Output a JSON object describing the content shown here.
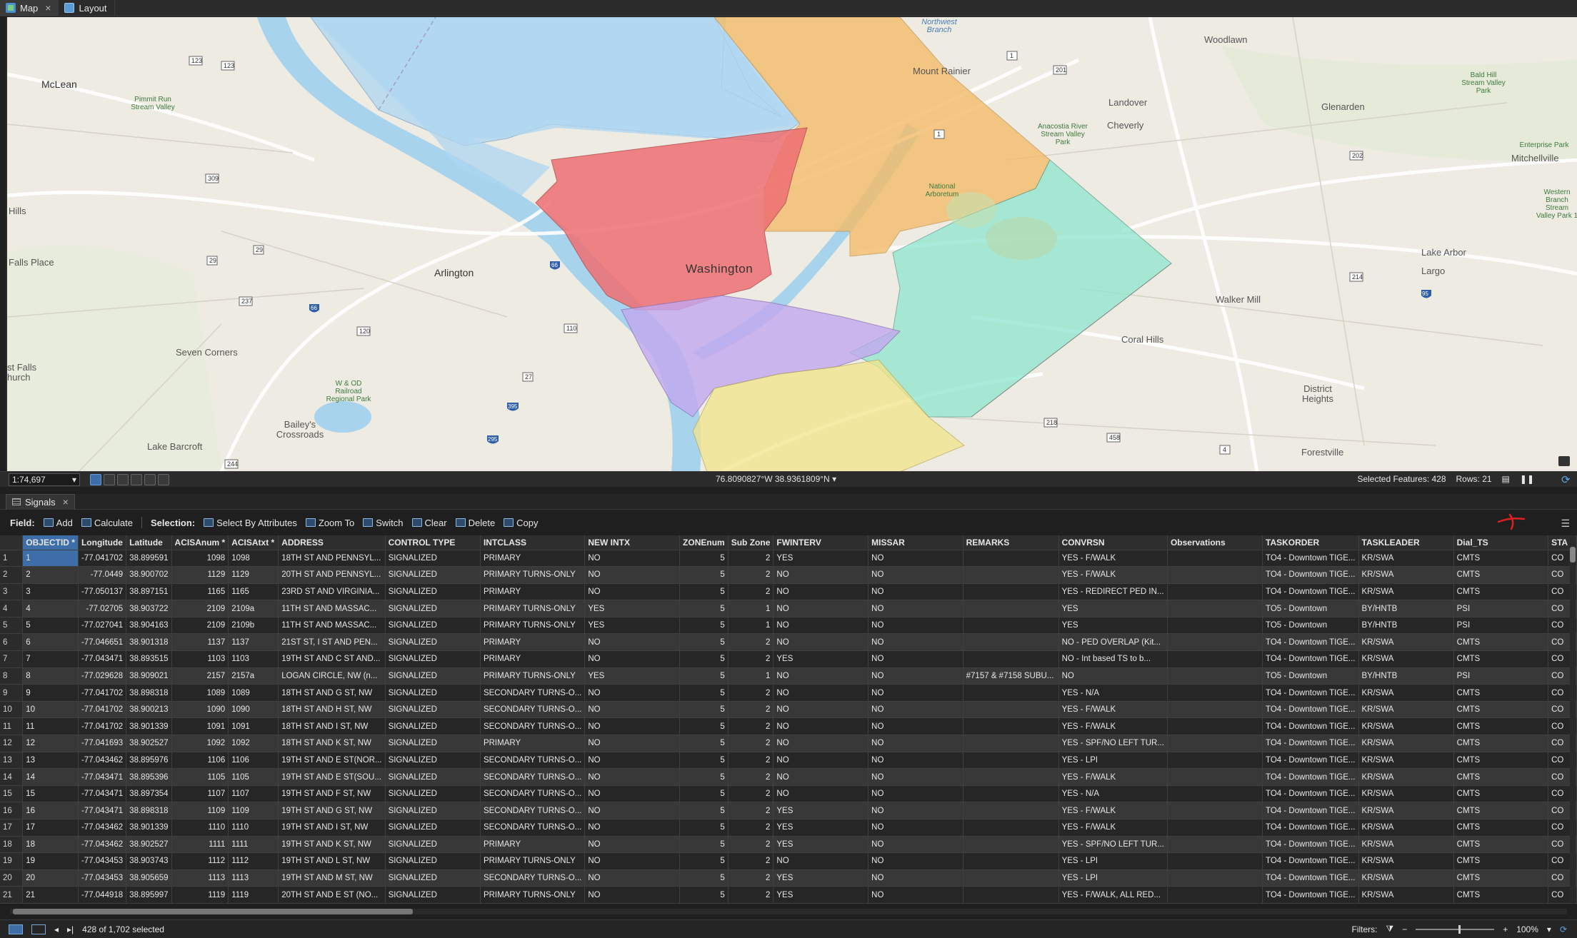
{
  "tabs": [
    {
      "label": "Map"
    },
    {
      "label": "Layout"
    }
  ],
  "map": {
    "labels": {
      "mclean": "McLean",
      "arlington": "Arlington",
      "washington": "Washington",
      "mount_rainier": "Mount Rainier",
      "woodlawn": "Woodlawn",
      "landover": "Landover",
      "cheverly": "Cheverly",
      "glenarden": "Glenarden",
      "mitchellville": "Mitchellville",
      "lake_arbor": "Lake Arbor",
      "largo": "Largo",
      "walker_mill": "Walker Mill",
      "coral_hills": "Coral Hills",
      "district_heights": "District Heights",
      "forestville": "Forestville",
      "seven_corners": "Seven Corners",
      "baileys": "Bailey's Crossroads",
      "lake_barcroft": "Lake Barcroft",
      "falls_place": "Falls Place",
      "hills": "Hills",
      "falls_church": "st Falls hurch",
      "northwest_branch": "Northwest Branch",
      "pimmit_run": "Pimmit Run Stream Valley",
      "wod_railroad": "W & OD Railroad Regional Park",
      "anacostia": "Anacostia River Stream Valley Park",
      "national_arboretum": "National Arboretum",
      "bald_hill": "Bald Hill Stream Valley Park",
      "enterprise_park": "Enterprise Park",
      "western_branch": "Western Branch Stream Valley Park 1"
    }
  },
  "mapbar": {
    "scale": "1:74,697",
    "coordinates": "76.8090827°W 38.9361809°N",
    "selected_features": "Selected Features: 428",
    "rows": "Rows: 21"
  },
  "pane": {
    "tab_label": "Signals"
  },
  "toolbar": {
    "field_label": "Field:",
    "add": "Add",
    "calculate": "Calculate",
    "selection_label": "Selection:",
    "select_by_attributes": "Select By Attributes",
    "zoom_to": "Zoom To",
    "switch": "Switch",
    "clear": "Clear",
    "delete": "Delete",
    "copy": "Copy"
  },
  "table": {
    "columns": [
      "OBJECTID *",
      "Longitude",
      "Latitude",
      "ACISAnum *",
      "ACISAtxt *",
      "ADDRESS",
      "CONTROL TYPE",
      "INTCLASS",
      "NEW INTX",
      "ZONEnum",
      "Sub Zone",
      "FWINTERV",
      "MISSAR",
      "REMARKS",
      "CONVRSN",
      "Observations",
      "TASKORDER",
      "TASKLEADER",
      "Dial_TS",
      "STA"
    ],
    "rows": [
      [
        "1",
        "1",
        "-77.041702",
        "38.899591",
        "1098",
        "1098",
        "18TH ST AND PENNSYL...",
        "SIGNALIZED",
        "PRIMARY",
        "NO",
        "5",
        "2",
        "YES",
        "NO",
        "",
        "YES - F/WALK",
        "",
        "TO4 - Downtown TIGE...",
        "KR/SWA",
        "CMTS",
        "CO"
      ],
      [
        "2",
        "2",
        "-77.0449",
        "38.900702",
        "1129",
        "1129",
        "20TH ST AND PENNSYL...",
        "SIGNALIZED",
        "PRIMARY TURNS-ONLY",
        "NO",
        "5",
        "2",
        "NO",
        "NO",
        "",
        "YES - F/WALK",
        "",
        "TO4 - Downtown TIGE...",
        "KR/SWA",
        "CMTS",
        "CO"
      ],
      [
        "3",
        "3",
        "-77.050137",
        "38.897151",
        "1165",
        "1165",
        "23RD ST AND VIRGINIA...",
        "SIGNALIZED",
        "PRIMARY",
        "NO",
        "5",
        "2",
        "NO",
        "NO",
        "",
        "YES - REDIRECT PED IN...",
        "",
        "TO4 - Downtown TIGE...",
        "KR/SWA",
        "CMTS",
        "CO"
      ],
      [
        "4",
        "4",
        "-77.02705",
        "38.903722",
        "2109",
        "2109a",
        "11TH ST AND MASSAC...",
        "SIGNALIZED",
        "PRIMARY TURNS-ONLY",
        "YES",
        "5",
        "1",
        "NO",
        "NO",
        "",
        "YES",
        "",
        "TO5 - Downtown",
        "BY/HNTB",
        "PSI",
        "CO"
      ],
      [
        "5",
        "5",
        "-77.027041",
        "38.904163",
        "2109",
        "2109b",
        "11TH ST AND MASSAC...",
        "SIGNALIZED",
        "PRIMARY TURNS-ONLY",
        "YES",
        "5",
        "1",
        "NO",
        "NO",
        "",
        "YES",
        "",
        "TO5 - Downtown",
        "BY/HNTB",
        "PSI",
        "CO"
      ],
      [
        "6",
        "6",
        "-77.046651",
        "38.901318",
        "1137",
        "1137",
        "21ST ST, I ST AND PEN...",
        "SIGNALIZED",
        "PRIMARY",
        "NO",
        "5",
        "2",
        "NO",
        "NO",
        "",
        "NO - PED OVERLAP (Kit...",
        "",
        "TO4 - Downtown TIGE...",
        "KR/SWA",
        "CMTS",
        "CO"
      ],
      [
        "7",
        "7",
        "-77.043471",
        "38.893515",
        "1103",
        "1103",
        "19TH ST AND C ST AND...",
        "SIGNALIZED",
        "PRIMARY",
        "NO",
        "5",
        "2",
        "YES",
        "NO",
        "",
        "NO - Int based TS to b...",
        "",
        "TO4 - Downtown TIGE...",
        "KR/SWA",
        "CMTS",
        "CO"
      ],
      [
        "8",
        "8",
        "-77.029628",
        "38.909021",
        "2157",
        "2157a",
        "LOGAN CIRCLE, NW (n...",
        "SIGNALIZED",
        "PRIMARY TURNS-ONLY",
        "YES",
        "5",
        "1",
        "NO",
        "NO",
        "#7157 & #7158 SUBU...",
        "NO",
        "",
        "TO5 - Downtown",
        "BY/HNTB",
        "PSI",
        "CO"
      ],
      [
        "9",
        "9",
        "-77.041702",
        "38.898318",
        "1089",
        "1089",
        "18TH ST AND G ST, NW",
        "SIGNALIZED",
        "SECONDARY TURNS-O...",
        "NO",
        "5",
        "2",
        "NO",
        "NO",
        "",
        "YES - N/A",
        "",
        "TO4 - Downtown TIGE...",
        "KR/SWA",
        "CMTS",
        "CO"
      ],
      [
        "10",
        "10",
        "-77.041702",
        "38.900213",
        "1090",
        "1090",
        "18TH ST AND H ST, NW",
        "SIGNALIZED",
        "SECONDARY TURNS-O...",
        "NO",
        "5",
        "2",
        "NO",
        "NO",
        "",
        "YES - F/WALK",
        "",
        "TO4 - Downtown TIGE...",
        "KR/SWA",
        "CMTS",
        "CO"
      ],
      [
        "11",
        "11",
        "-77.041702",
        "38.901339",
        "1091",
        "1091",
        "18TH ST AND I ST, NW",
        "SIGNALIZED",
        "SECONDARY TURNS-O...",
        "NO",
        "5",
        "2",
        "NO",
        "NO",
        "",
        "YES - F/WALK",
        "",
        "TO4 - Downtown TIGE...",
        "KR/SWA",
        "CMTS",
        "CO"
      ],
      [
        "12",
        "12",
        "-77.041693",
        "38.902527",
        "1092",
        "1092",
        "18TH ST AND K ST, NW",
        "SIGNALIZED",
        "PRIMARY",
        "NO",
        "5",
        "2",
        "NO",
        "NO",
        "",
        "YES - SPF/NO LEFT TUR...",
        "",
        "TO4 - Downtown TIGE...",
        "KR/SWA",
        "CMTS",
        "CO"
      ],
      [
        "13",
        "13",
        "-77.043462",
        "38.895976",
        "1106",
        "1106",
        "19TH ST AND E ST(NOR...",
        "SIGNALIZED",
        "SECONDARY TURNS-O...",
        "NO",
        "5",
        "2",
        "NO",
        "NO",
        "",
        "YES - LPI",
        "",
        "TO4 - Downtown TIGE...",
        "KR/SWA",
        "CMTS",
        "CO"
      ],
      [
        "14",
        "14",
        "-77.043471",
        "38.895396",
        "1105",
        "1105",
        "19TH ST AND E ST(SOU...",
        "SIGNALIZED",
        "SECONDARY TURNS-O...",
        "NO",
        "5",
        "2",
        "NO",
        "NO",
        "",
        "YES - F/WALK",
        "",
        "TO4 - Downtown TIGE...",
        "KR/SWA",
        "CMTS",
        "CO"
      ],
      [
        "15",
        "15",
        "-77.043471",
        "38.897354",
        "1107",
        "1107",
        "19TH ST AND F ST, NW",
        "SIGNALIZED",
        "SECONDARY TURNS-O...",
        "NO",
        "5",
        "2",
        "NO",
        "NO",
        "",
        "YES - N/A",
        "",
        "TO4 - Downtown TIGE...",
        "KR/SWA",
        "CMTS",
        "CO"
      ],
      [
        "16",
        "16",
        "-77.043471",
        "38.898318",
        "1109",
        "1109",
        "19TH ST AND G ST, NW",
        "SIGNALIZED",
        "SECONDARY TURNS-O...",
        "NO",
        "5",
        "2",
        "YES",
        "NO",
        "",
        "YES - F/WALK",
        "",
        "TO4 - Downtown TIGE...",
        "KR/SWA",
        "CMTS",
        "CO"
      ],
      [
        "17",
        "17",
        "-77.043462",
        "38.901339",
        "1110",
        "1110",
        "19TH ST AND I ST, NW",
        "SIGNALIZED",
        "SECONDARY TURNS-O...",
        "NO",
        "5",
        "2",
        "YES",
        "NO",
        "",
        "YES - F/WALK",
        "",
        "TO4 - Downtown TIGE...",
        "KR/SWA",
        "CMTS",
        "CO"
      ],
      [
        "18",
        "18",
        "-77.043462",
        "38.902527",
        "1111",
        "1111",
        "19TH ST AND K ST, NW",
        "SIGNALIZED",
        "PRIMARY",
        "NO",
        "5",
        "2",
        "YES",
        "NO",
        "",
        "YES - SPF/NO LEFT TUR...",
        "",
        "TO4 - Downtown TIGE...",
        "KR/SWA",
        "CMTS",
        "CO"
      ],
      [
        "19",
        "19",
        "-77.043453",
        "38.903743",
        "1112",
        "1112",
        "19TH ST AND L ST, NW",
        "SIGNALIZED",
        "PRIMARY TURNS-ONLY",
        "NO",
        "5",
        "2",
        "NO",
        "NO",
        "",
        "YES - LPI",
        "",
        "TO4 - Downtown TIGE...",
        "KR/SWA",
        "CMTS",
        "CO"
      ],
      [
        "20",
        "20",
        "-77.043453",
        "38.905659",
        "1113",
        "1113",
        "19TH ST AND M ST, NW",
        "SIGNALIZED",
        "SECONDARY TURNS-O...",
        "NO",
        "5",
        "2",
        "YES",
        "NO",
        "",
        "YES - LPI",
        "",
        "TO4 - Downtown TIGE...",
        "KR/SWA",
        "CMTS",
        "CO"
      ],
      [
        "21",
        "21",
        "-77.044918",
        "38.895997",
        "1119",
        "1119",
        "20TH ST AND E ST (NO...",
        "SIGNALIZED",
        "PRIMARY TURNS-ONLY",
        "NO",
        "5",
        "2",
        "YES",
        "NO",
        "",
        "YES - F/WALK, ALL RED...",
        "",
        "TO4 - Downtown TIGE...",
        "KR/SWA",
        "CMTS",
        "CO"
      ]
    ]
  },
  "bottombar": {
    "selection_count": "428 of 1,702 selected",
    "filters_label": "Filters:",
    "zoom": "100%"
  },
  "colors": {
    "accent": "#3e6ea8",
    "zone_red": "#ef6f73",
    "zone_orange": "#f4bc6a",
    "zone_blue": "#aed6f2",
    "zone_teal": "#8ee6cf",
    "zone_purple": "#c3a8f0",
    "zone_yellow": "#f3e58a"
  }
}
